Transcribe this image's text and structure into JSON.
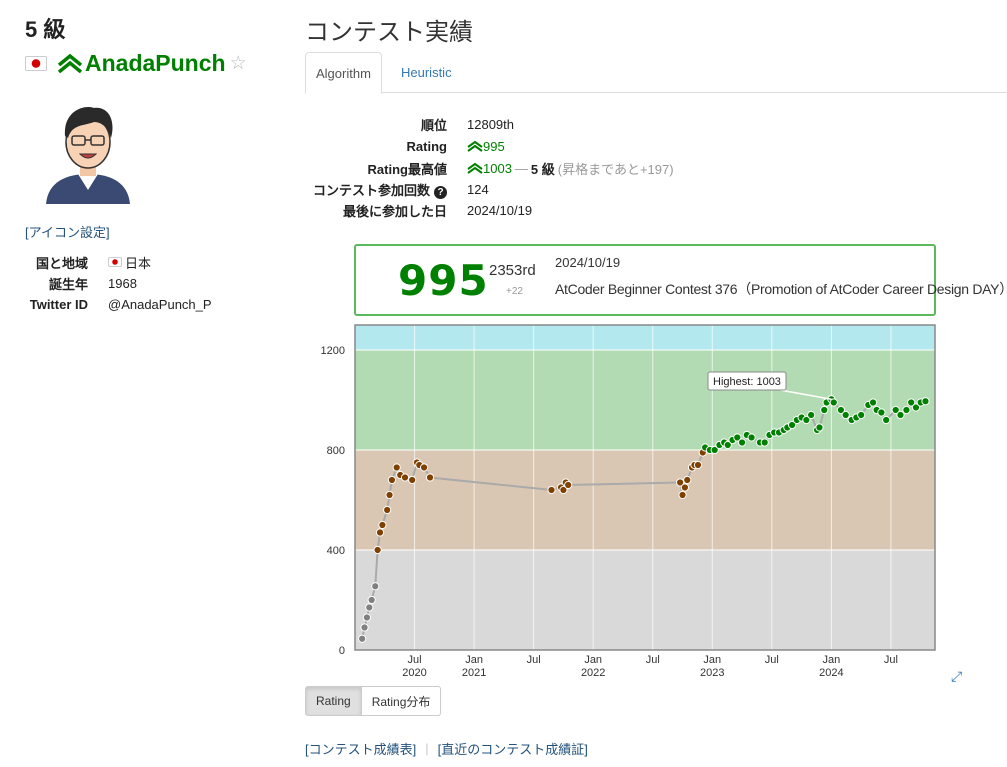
{
  "profile": {
    "rank_title": "5 級",
    "username": "AnadaPunch",
    "icon_setting_link": "[アイコン設定]",
    "fields": [
      {
        "label": "国と地域",
        "value": "日本",
        "flag": "japan-flag-icon"
      },
      {
        "label": "誕生年",
        "value": "1968"
      },
      {
        "label": "Twitter ID",
        "value": "@AnadaPunch_P"
      }
    ]
  },
  "page_title": "コンテスト実績",
  "tabs": [
    {
      "label": "Algorithm",
      "active": true
    },
    {
      "label": "Heuristic",
      "active": false
    }
  ],
  "stats": {
    "rank_label": "順位",
    "rank_value": "12809th",
    "rating_label": "Rating",
    "rating_value": "995",
    "highest_label": "Rating最高値",
    "highest_value": "1003",
    "highest_dash": "—",
    "highest_kyu": "5 級",
    "highest_note": "(昇格まであと+197)",
    "count_label": "コンテスト参加回数",
    "count_value": "124",
    "last_label": "最後に参加した日",
    "last_value": "2024/10/19"
  },
  "status_box": {
    "rating": "995",
    "place": "2353rd",
    "diff": "+22",
    "date": "2024/10/19",
    "contest": "AtCoder Beginner Contest 376（Promotion of AtCoder Career Design DAY）"
  },
  "colors": {
    "green_user": "#008000",
    "band_cyan": "#b3e9ee",
    "band_green": "#b3dbb3",
    "band_brown": "#d9c7b3",
    "band_grey": "#d9d9d9"
  },
  "chart_data": {
    "type": "line",
    "ylim": [
      0,
      1300
    ],
    "y_ticks": [
      "0",
      "400",
      "800",
      "1200"
    ],
    "x_ticks": [
      {
        "month": "Jul",
        "year": "2020",
        "t": 2020.5
      },
      {
        "month": "Jan",
        "year": "2021",
        "t": 2021.0
      },
      {
        "month": "Jul",
        "year": "",
        "t": 2021.5
      },
      {
        "month": "Jan",
        "year": "2022",
        "t": 2022.0
      },
      {
        "month": "Jul",
        "year": "",
        "t": 2022.5
      },
      {
        "month": "Jan",
        "year": "2023",
        "t": 2023.0
      },
      {
        "month": "Jul",
        "year": "",
        "t": 2023.5
      },
      {
        "month": "Jan",
        "year": "2024",
        "t": 2024.0
      },
      {
        "month": "Jul",
        "year": "",
        "t": 2024.5
      }
    ],
    "xlim": [
      2020.0,
      2024.87
    ],
    "highest_label": "Highest: 1003",
    "series": [
      {
        "points": [
          [
            2020.06,
            45
          ],
          [
            2020.08,
            90
          ],
          [
            2020.1,
            130
          ],
          [
            2020.12,
            170
          ],
          [
            2020.14,
            200
          ],
          [
            2020.17,
            255
          ],
          [
            2020.19,
            400
          ],
          [
            2020.21,
            470
          ],
          [
            2020.23,
            500
          ],
          [
            2020.27,
            560
          ],
          [
            2020.29,
            620
          ],
          [
            2020.31,
            680
          ],
          [
            2020.35,
            730
          ],
          [
            2020.38,
            700
          ],
          [
            2020.42,
            690
          ],
          [
            2020.48,
            680
          ],
          [
            2020.52,
            750
          ],
          [
            2020.54,
            740
          ],
          [
            2020.58,
            730
          ],
          [
            2020.63,
            690
          ],
          [
            2021.65,
            640
          ],
          [
            2021.73,
            650
          ],
          [
            2021.75,
            640
          ],
          [
            2021.77,
            670
          ],
          [
            2021.79,
            660
          ],
          [
            2022.73,
            670
          ],
          [
            2022.75,
            620
          ],
          [
            2022.77,
            650
          ],
          [
            2022.79,
            680
          ],
          [
            2022.83,
            730
          ],
          [
            2022.85,
            740
          ],
          [
            2022.88,
            740
          ],
          [
            2022.92,
            790
          ],
          [
            2022.94,
            810
          ],
          [
            2022.98,
            800
          ],
          [
            2023.02,
            800
          ],
          [
            2023.06,
            820
          ],
          [
            2023.1,
            830
          ],
          [
            2023.13,
            820
          ],
          [
            2023.17,
            840
          ],
          [
            2023.21,
            850
          ],
          [
            2023.25,
            830
          ],
          [
            2023.29,
            860
          ],
          [
            2023.33,
            850
          ],
          [
            2023.4,
            830
          ],
          [
            2023.44,
            830
          ],
          [
            2023.48,
            860
          ],
          [
            2023.52,
            870
          ],
          [
            2023.56,
            870
          ],
          [
            2023.6,
            880
          ],
          [
            2023.63,
            890
          ],
          [
            2023.67,
            900
          ],
          [
            2023.71,
            920
          ],
          [
            2023.75,
            930
          ],
          [
            2023.79,
            920
          ],
          [
            2023.83,
            940
          ],
          [
            2023.88,
            880
          ],
          [
            2023.9,
            890
          ],
          [
            2023.94,
            960
          ],
          [
            2023.96,
            990
          ],
          [
            2024.0,
            1003
          ],
          [
            2024.02,
            990
          ],
          [
            2024.08,
            960
          ],
          [
            2024.12,
            940
          ],
          [
            2024.17,
            920
          ],
          [
            2024.21,
            930
          ],
          [
            2024.25,
            940
          ],
          [
            2024.31,
            980
          ],
          [
            2024.35,
            990
          ],
          [
            2024.38,
            960
          ],
          [
            2024.42,
            950
          ],
          [
            2024.46,
            920
          ],
          [
            2024.54,
            960
          ],
          [
            2024.58,
            940
          ],
          [
            2024.63,
            960
          ],
          [
            2024.67,
            990
          ],
          [
            2024.71,
            970
          ],
          [
            2024.75,
            990
          ],
          [
            2024.79,
            995
          ]
        ]
      }
    ]
  },
  "buttons": {
    "rating": "Rating",
    "distribution": "Rating分布"
  },
  "links": {
    "history": "[コンテスト成績表]",
    "certificate": "[直近のコンテスト成績証]"
  }
}
